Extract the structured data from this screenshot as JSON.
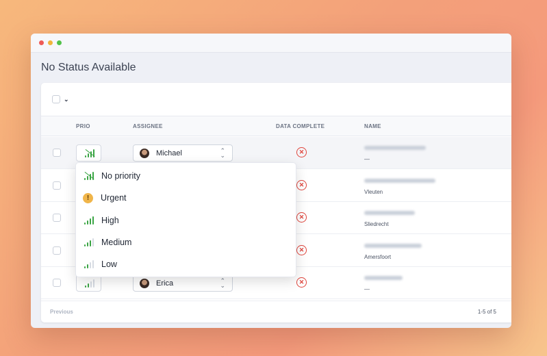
{
  "window": {
    "dots": [
      "red",
      "yellow",
      "green"
    ]
  },
  "page": {
    "title": "No Status Available"
  },
  "table": {
    "columns": {
      "prio": "PRIO",
      "assignee": "ASSIGNEE",
      "data_complete": "DATA COMPLETE",
      "name": "NAME"
    },
    "rows": [
      {
        "assignee": "Michael",
        "city": "—",
        "prio_icon": "no-priority-icon"
      },
      {
        "assignee": "",
        "city": "Vleuten",
        "prio_icon": ""
      },
      {
        "assignee": "",
        "city": "Sliedrecht",
        "prio_icon": ""
      },
      {
        "assignee": "",
        "city": "Amersfoort",
        "prio_icon": ""
      },
      {
        "assignee": "Erica",
        "city": "—",
        "prio_icon": "low-priority-icon"
      }
    ]
  },
  "footer": {
    "previous": "Previous",
    "count": "1-5 of 5"
  },
  "dropdown": {
    "options": [
      {
        "label": "No priority",
        "icon": "no-priority-icon"
      },
      {
        "label": "Urgent",
        "icon": "urgent-icon"
      },
      {
        "label": "High",
        "icon": "high-priority-icon"
      },
      {
        "label": "Medium",
        "icon": "medium-priority-icon"
      },
      {
        "label": "Low",
        "icon": "low-priority-icon"
      }
    ],
    "urgent_glyph": "!"
  },
  "colors": {
    "accent_green": "#3aa544",
    "error_red": "#e0453c",
    "urgent_yellow": "#f0b54a"
  }
}
